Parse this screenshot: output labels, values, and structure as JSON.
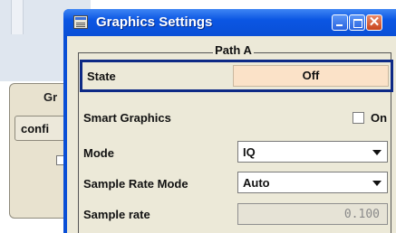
{
  "background_window": {
    "label_partial": "Gr",
    "button_partial": "confi"
  },
  "window": {
    "title": "Graphics Settings",
    "close_glyph": "✕"
  },
  "group": {
    "title": "Path A"
  },
  "state": {
    "label": "State",
    "value": "Off"
  },
  "smart_graphics": {
    "label": "Smart Graphics",
    "checkbox_label": "On",
    "checked": false
  },
  "mode": {
    "label": "Mode",
    "value": "IQ"
  },
  "sample_rate_mode": {
    "label": "Sample Rate Mode",
    "value": "Auto"
  },
  "sample_rate": {
    "label": "Sample rate",
    "value": "0.100"
  },
  "colors": {
    "titlebar": "#0a4fd6",
    "dialog_bg": "#ece9d8",
    "state_value_bg": "#fbe2c8",
    "focus_border": "#0e2a86"
  }
}
